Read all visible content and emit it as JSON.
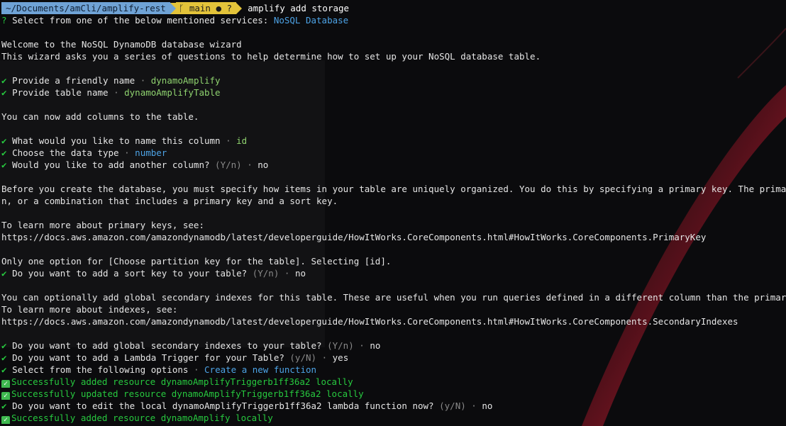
{
  "prompt": {
    "path": "~/Documents/amCli/amplify-rest",
    "branch_icon": "git-branch-icon",
    "branch": "main",
    "status_dot": "●",
    "status_q": "?",
    "command": "amplify add storage"
  },
  "lines": {
    "select_service_q": "?",
    "select_service": "Select from one of the below mentioned services:",
    "select_service_val": "NoSQL Database",
    "welcome": "Welcome to the NoSQL DynamoDB database wizard",
    "wizard_desc": "This wizard asks you a series of questions to help determine how to set up your NoSQL database table.",
    "friendly_name_q": "Provide a friendly name",
    "friendly_name_val": "dynamoAmplify",
    "table_name_q": "Provide table name",
    "table_name_val": "dynamoAmplifyTable",
    "add_columns": "You can now add columns to the table.",
    "col_name_q": "What would you like to name this column",
    "col_name_val": "id",
    "data_type_q": "Choose the data type",
    "data_type_val": "number",
    "another_col_q": "Would you like to add another column?",
    "another_col_hint": "(Y/n)",
    "another_col_val": "no",
    "pk_desc_1": "Before you create the database, you must specify how items in your table are uniquely organized. You do this by specifying a primary key. The primary key uniq",
    "pk_desc_2": "n, or a combination that includes a primary key and a sort key.",
    "learn_pk": "To learn more about primary keys, see:",
    "pk_url": "https://docs.aws.amazon.com/amazondynamodb/latest/developerguide/HowItWorks.CoreComponents.html#HowItWorks.CoreComponents.PrimaryKey",
    "only_one": "Only one option for [Choose partition key for the table]. Selecting [id].",
    "sort_key_q": "Do you want to add a sort key to your table?",
    "sort_key_hint": "(Y/n)",
    "sort_key_val": "no",
    "gsi_desc": "You can optionally add global secondary indexes for this table. These are useful when you run queries defined in a different column than the primary key.",
    "learn_idx": "To learn more about indexes, see:",
    "idx_url": "https://docs.aws.amazon.com/amazondynamodb/latest/developerguide/HowItWorks.CoreComponents.html#HowItWorks.CoreComponents.SecondaryIndexes",
    "gsi_q": "Do you want to add global secondary indexes to your table?",
    "gsi_hint": "(Y/n)",
    "gsi_val": "no",
    "lambda_q": "Do you want to add a Lambda Trigger for your Table?",
    "lambda_hint": "(y/N)",
    "lambda_val": "yes",
    "select_opt_q": "Select from the following options",
    "select_opt_val": "Create a new function",
    "success_1": "Successfully added resource dynamoAmplifyTriggerb1ff36a2 locally",
    "success_2": "Successfully updated resource dynamoAmplifyTriggerb1ff36a2 locally",
    "edit_q": "Do you want to edit the local dynamoAmplifyTriggerb1ff36a2 lambda function now?",
    "edit_hint": "(y/N)",
    "edit_val": "no",
    "success_3": "Successfully added resource dynamoAmplify locally"
  },
  "symbols": {
    "check": "✔",
    "sep": "·",
    "success_mark": "✓"
  },
  "colors": {
    "background": "#0c0c0e",
    "answer_green": "#8fd36f",
    "answer_blue": "#4da3e6",
    "check_green": "#27c93f",
    "prompt_path_bg": "#6fa3d6",
    "prompt_git_bg": "#e3c33a"
  }
}
